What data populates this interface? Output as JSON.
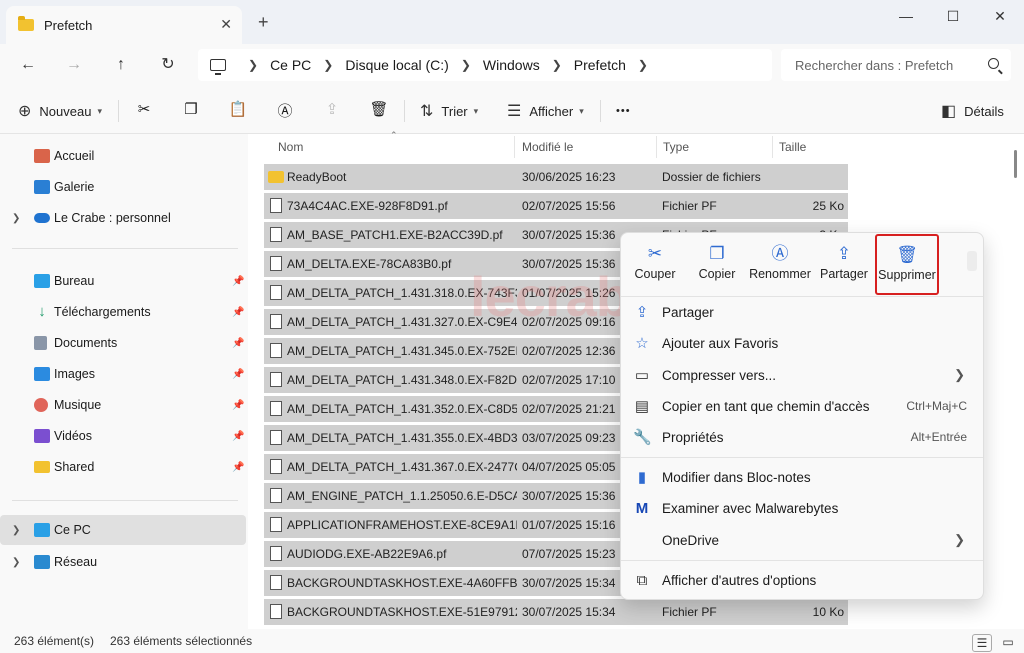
{
  "window": {
    "tab_title": "Prefetch",
    "close_tab": "✕",
    "new_tab": "+",
    "minimize": "—",
    "maximize": "☐",
    "close": "✕"
  },
  "nav": {
    "breadcrumb": [
      "Ce PC",
      "Disque local (C:)",
      "Windows",
      "Prefetch"
    ],
    "search_placeholder": "Rechercher dans : Prefetch"
  },
  "toolbar": {
    "new_label": "Nouveau",
    "sort_label": "Trier",
    "view_label": "Afficher",
    "more_label": "•••",
    "details_label": "Détails"
  },
  "sidebar": {
    "top": [
      {
        "label": "Accueil",
        "icon": "home-icon",
        "color": "#d9644a"
      },
      {
        "label": "Galerie",
        "icon": "gallery-icon",
        "color": "#2a7fd4"
      },
      {
        "label": "Le Crabe : personnel",
        "icon": "onedrive-icon",
        "color": "#1f73d0"
      }
    ],
    "pinned": [
      {
        "label": "Bureau",
        "icon": "desktop-icon",
        "color": "#2aa0e6"
      },
      {
        "label": "Téléchargements",
        "icon": "download-icon",
        "color": "#1e9a6a"
      },
      {
        "label": "Documents",
        "icon": "documents-icon",
        "color": "#8a96a8"
      },
      {
        "label": "Images",
        "icon": "images-icon",
        "color": "#2b8be0"
      },
      {
        "label": "Musique",
        "icon": "music-icon",
        "color": "#e0655a"
      },
      {
        "label": "Vidéos",
        "icon": "videos-icon",
        "color": "#7b4fd0"
      },
      {
        "label": "Shared",
        "icon": "folder-icon",
        "color": "#f2c230"
      }
    ],
    "bottom": [
      {
        "label": "Ce PC",
        "icon": "pc-icon",
        "color": "#2aa0e6"
      },
      {
        "label": "Réseau",
        "icon": "network-icon",
        "color": "#2a8ad0"
      }
    ]
  },
  "columns": {
    "name": "Nom",
    "modified": "Modifié le",
    "type": "Type",
    "size": "Taille"
  },
  "files": [
    {
      "name": "ReadyBoot",
      "date": "30/06/2025 16:23",
      "type": "Dossier de fichiers",
      "size": "",
      "folder": true
    },
    {
      "name": "73A4C4AC.EXE-928F8D91.pf",
      "date": "02/07/2025 15:56",
      "type": "Fichier PF",
      "size": "25 Ko"
    },
    {
      "name": "AM_BASE_PATCH1.EXE-B2ACC39D.pf",
      "date": "30/07/2025 15:36",
      "type": "Fichier PF",
      "size": "3 Ko"
    },
    {
      "name": "AM_DELTA.EXE-78CA83B0.pf",
      "date": "30/07/2025 15:36",
      "type": "",
      "size": ""
    },
    {
      "name": "AM_DELTA_PATCH_1.431.318.0.EX-743F35...",
      "date": "01/07/2025 15:26",
      "type": "",
      "size": ""
    },
    {
      "name": "AM_DELTA_PATCH_1.431.327.0.EX-C9E47...",
      "date": "02/07/2025 09:16",
      "type": "",
      "size": ""
    },
    {
      "name": "AM_DELTA_PATCH_1.431.345.0.EX-752EFF...",
      "date": "02/07/2025 12:36",
      "type": "",
      "size": ""
    },
    {
      "name": "AM_DELTA_PATCH_1.431.348.0.EX-F82DA...",
      "date": "02/07/2025 17:10",
      "type": "",
      "size": ""
    },
    {
      "name": "AM_DELTA_PATCH_1.431.352.0.EX-C8D52...",
      "date": "02/07/2025 21:21",
      "type": "",
      "size": ""
    },
    {
      "name": "AM_DELTA_PATCH_1.431.355.0.EX-4BD3D...",
      "date": "03/07/2025 09:23",
      "type": "",
      "size": ""
    },
    {
      "name": "AM_DELTA_PATCH_1.431.367.0.EX-2477C...",
      "date": "04/07/2025 05:05",
      "type": "",
      "size": ""
    },
    {
      "name": "AM_ENGINE_PATCH_1.1.25050.6.E-D5CA5...",
      "date": "30/07/2025 15:36",
      "type": "",
      "size": ""
    },
    {
      "name": "APPLICATIONFRAMEHOST.EXE-8CE9A1E...",
      "date": "01/07/2025 15:16",
      "type": "",
      "size": ""
    },
    {
      "name": "AUDIODG.EXE-AB22E9A6.pf",
      "date": "07/07/2025 15:23",
      "type": "",
      "size": ""
    },
    {
      "name": "BACKGROUNDTASKHOST.EXE-4A60FFBA...",
      "date": "30/07/2025 15:34",
      "type": "",
      "size": ""
    },
    {
      "name": "BACKGROUNDTASKHOST.EXE-51E97912...",
      "date": "30/07/2025 15:34",
      "type": "Fichier PF",
      "size": "10 Ko"
    }
  ],
  "watermark": "lecrabeinfo",
  "context_menu": {
    "quick_actions": [
      {
        "label": "Couper",
        "icon": "cut-icon"
      },
      {
        "label": "Copier",
        "icon": "copy-icon"
      },
      {
        "label": "Renommer",
        "icon": "rename-icon"
      },
      {
        "label": "Partager",
        "icon": "share-icon"
      },
      {
        "label": "Supprimer",
        "icon": "trash-icon"
      }
    ],
    "items": [
      {
        "label": "Partager",
        "icon": "share-icon",
        "shortcut": ""
      },
      {
        "label": "Ajouter aux Favoris",
        "icon": "star-icon",
        "shortcut": ""
      },
      {
        "label": "Compresser vers...",
        "icon": "zip-icon",
        "shortcut": "",
        "submenu": true
      },
      {
        "label": "Copier en tant que chemin d'accès",
        "icon": "path-icon",
        "shortcut": "Ctrl+Maj+C"
      },
      {
        "label": "Propriétés",
        "icon": "wrench-icon",
        "shortcut": "Alt+Entrée"
      },
      {
        "label": "Modifier dans Bloc-notes",
        "icon": "notepad-icon",
        "shortcut": ""
      },
      {
        "label": "Examiner avec Malwarebytes",
        "icon": "malwarebytes-icon",
        "shortcut": ""
      },
      {
        "label": "OneDrive",
        "icon": "",
        "shortcut": "",
        "submenu": true
      },
      {
        "label": "Afficher d'autres d'options",
        "icon": "more-options-icon",
        "shortcut": ""
      }
    ],
    "highlight_color": "#d72020"
  },
  "status": {
    "count": "263 élément(s)",
    "selected": "263 éléments sélectionnés"
  }
}
